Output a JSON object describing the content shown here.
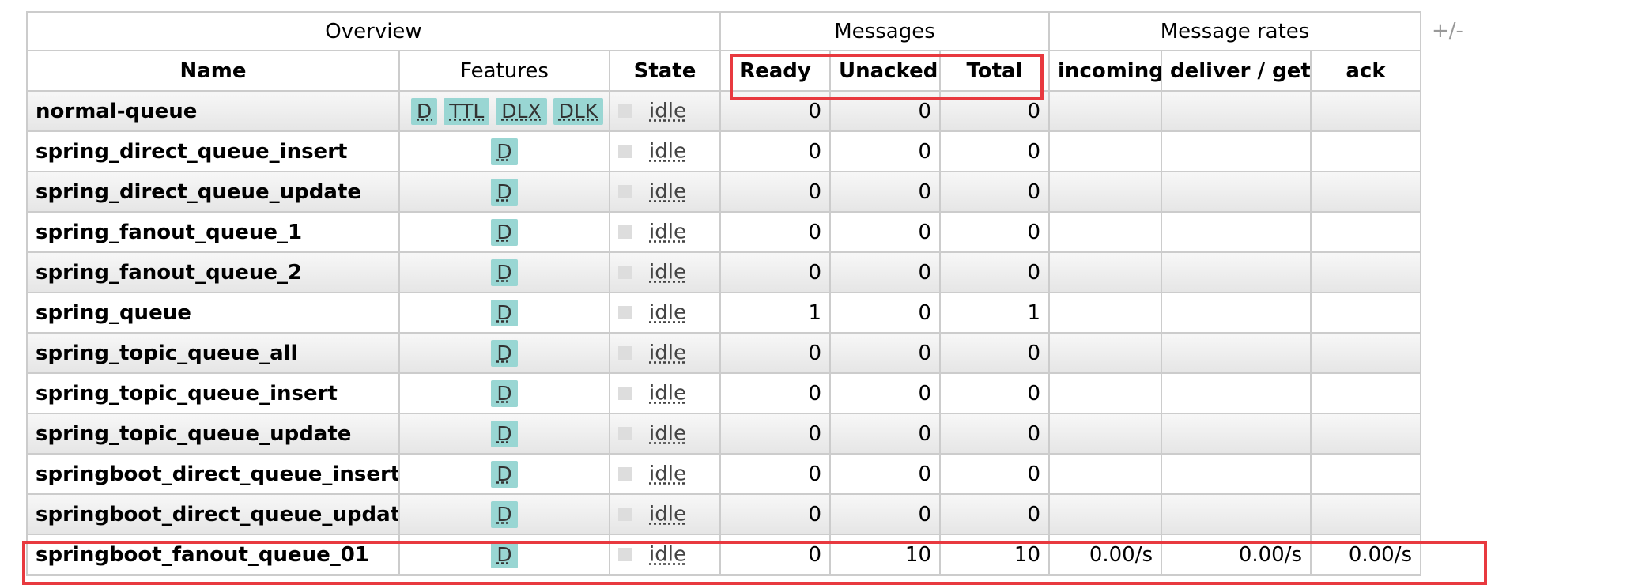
{
  "toggle_label": "+/-",
  "groups": {
    "overview": "Overview",
    "messages": "Messages",
    "rates": "Message rates"
  },
  "columns": {
    "name": "Name",
    "features": "Features",
    "state": "State",
    "ready": "Ready",
    "unacked": "Unacked",
    "total": "Total",
    "incoming": "incoming",
    "deliver_get": "deliver / get",
    "ack": "ack"
  },
  "queues": [
    {
      "name": "normal-queue",
      "features": [
        "D",
        "TTL",
        "DLX",
        "DLK"
      ],
      "state": "idle",
      "ready": "0",
      "unacked": "0",
      "total": "0",
      "incoming": "",
      "deliver": "",
      "ack": ""
    },
    {
      "name": "spring_direct_queue_insert",
      "features": [
        "D"
      ],
      "state": "idle",
      "ready": "0",
      "unacked": "0",
      "total": "0",
      "incoming": "",
      "deliver": "",
      "ack": ""
    },
    {
      "name": "spring_direct_queue_update",
      "features": [
        "D"
      ],
      "state": "idle",
      "ready": "0",
      "unacked": "0",
      "total": "0",
      "incoming": "",
      "deliver": "",
      "ack": ""
    },
    {
      "name": "spring_fanout_queue_1",
      "features": [
        "D"
      ],
      "state": "idle",
      "ready": "0",
      "unacked": "0",
      "total": "0",
      "incoming": "",
      "deliver": "",
      "ack": ""
    },
    {
      "name": "spring_fanout_queue_2",
      "features": [
        "D"
      ],
      "state": "idle",
      "ready": "0",
      "unacked": "0",
      "total": "0",
      "incoming": "",
      "deliver": "",
      "ack": ""
    },
    {
      "name": "spring_queue",
      "features": [
        "D"
      ],
      "state": "idle",
      "ready": "1",
      "unacked": "0",
      "total": "1",
      "incoming": "",
      "deliver": "",
      "ack": ""
    },
    {
      "name": "spring_topic_queue_all",
      "features": [
        "D"
      ],
      "state": "idle",
      "ready": "0",
      "unacked": "0",
      "total": "0",
      "incoming": "",
      "deliver": "",
      "ack": ""
    },
    {
      "name": "spring_topic_queue_insert",
      "features": [
        "D"
      ],
      "state": "idle",
      "ready": "0",
      "unacked": "0",
      "total": "0",
      "incoming": "",
      "deliver": "",
      "ack": ""
    },
    {
      "name": "spring_topic_queue_update",
      "features": [
        "D"
      ],
      "state": "idle",
      "ready": "0",
      "unacked": "0",
      "total": "0",
      "incoming": "",
      "deliver": "",
      "ack": ""
    },
    {
      "name": "springboot_direct_queue_insert",
      "features": [
        "D"
      ],
      "state": "idle",
      "ready": "0",
      "unacked": "0",
      "total": "0",
      "incoming": "",
      "deliver": "",
      "ack": ""
    },
    {
      "name": "springboot_direct_queue_update",
      "features": [
        "D"
      ],
      "state": "idle",
      "ready": "0",
      "unacked": "0",
      "total": "0",
      "incoming": "",
      "deliver": "",
      "ack": ""
    },
    {
      "name": "springboot_fanout_queue_01",
      "features": [
        "D"
      ],
      "state": "idle",
      "ready": "0",
      "unacked": "10",
      "total": "10",
      "incoming": "0.00/s",
      "deliver": "0.00/s",
      "ack": "0.00/s"
    }
  ],
  "colors": {
    "tag_bg": "#99d6d3",
    "highlight": "#e8393f",
    "border": "#cccccc"
  }
}
